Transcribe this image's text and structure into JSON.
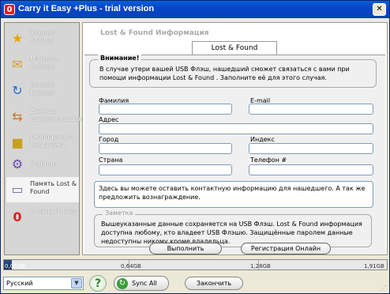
{
  "window": {
    "title": "Carry it Easy +Plus - trial version",
    "close_glyph": "✕"
  },
  "sidebar": {
    "items": [
      {
        "label": "Internet Options",
        "icon": "star-icon",
        "glyph": "★",
        "color": "#e8a800",
        "selected": false
      },
      {
        "label": "Microsoft Outlook",
        "icon": "outlook-icon",
        "glyph": "✉",
        "color": "#d9a020",
        "selected": false
      },
      {
        "label": "Outlook Express",
        "icon": "outlook-express-icon",
        "glyph": "↻",
        "color": "#2a6ad0",
        "selected": false
      },
      {
        "label": "Данные Синхронизация",
        "icon": "sync-data-icon",
        "glyph": "⇆",
        "color": "#c8752a",
        "selected": false
      },
      {
        "label": "Безопасность Настройки",
        "icon": "lock-icon",
        "glyph": "🔒",
        "color": "#c8a020",
        "selected": false
      },
      {
        "label": "Settings",
        "icon": "settings-icon",
        "glyph": "⚙",
        "color": "#6a4ab0",
        "selected": false
      },
      {
        "label": "Память Lost & Found",
        "icon": "usb-drive-icon",
        "glyph": "▭",
        "color": "#6a6a9a",
        "selected": true
      },
      {
        "label": "О Carry it Easy",
        "icon": "app-logo-icon",
        "glyph": "0",
        "color": "#e21d1d",
        "selected": false
      }
    ]
  },
  "content": {
    "header": "Lost & Found Информация",
    "tab_label": "Lost & Found",
    "notice": {
      "legend": "Внимание!",
      "text": "В случае утери вашей USB Флэш, нашедший сможет связаться с вами при помощи информации Lost & Found . Заполните её для этого случая."
    },
    "fields": {
      "last_name": "Фамилия",
      "email": "E-mail",
      "address": "Адрес",
      "city": "Город",
      "zip": "Индекс",
      "country": "Страна",
      "phone": "Телефон #"
    },
    "message": "Здесь вы можете оставить контактную информацию для нашедшего. А так же предложить вознаграждение.",
    "note": {
      "legend": "Заметка",
      "text": "Вышеуказанные данные сохраняется на USB Флэш. Lost & Found информация доступна любому, кто владеет USB Флэшю. Защищённые паролем данные недоступны никому кроме владельца."
    },
    "buttons": {
      "execute": "Выполнить",
      "register": "Регистрация Онлайн"
    }
  },
  "progress": {
    "used_fraction": 0.02,
    "labels": [
      "0,00GB",
      "0,64GB",
      "1,28GB",
      "1,91GB"
    ]
  },
  "footer": {
    "language": "Русский",
    "help_glyph": "?",
    "sync_label": "Sync All",
    "exit_label": "Закончить"
  }
}
